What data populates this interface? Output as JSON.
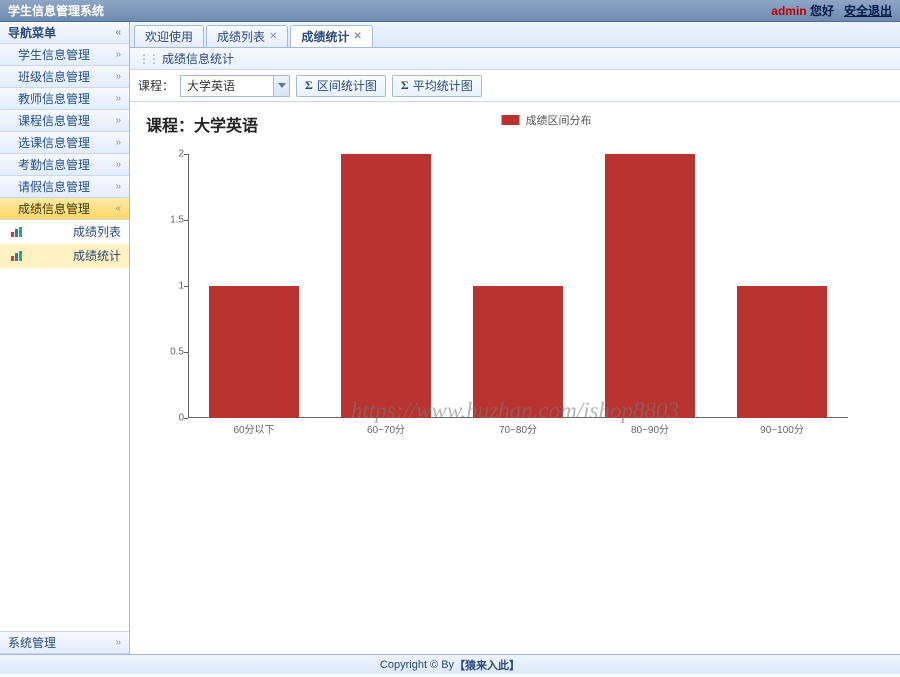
{
  "header": {
    "title": "学生信息管理系统",
    "user": "admin",
    "greet": "您好",
    "logout": "安全退出"
  },
  "sidebar": {
    "title": "导航菜单",
    "items": [
      {
        "label": "学生信息管理",
        "chev": "»"
      },
      {
        "label": "班级信息管理",
        "chev": "»"
      },
      {
        "label": "教师信息管理",
        "chev": "»"
      },
      {
        "label": "课程信息管理",
        "chev": "»"
      },
      {
        "label": "选课信息管理",
        "chev": "»"
      },
      {
        "label": "考勤信息管理",
        "chev": "»"
      },
      {
        "label": "请假信息管理",
        "chev": "»"
      },
      {
        "label": "成绩信息管理",
        "chev": "«"
      }
    ],
    "subitems": [
      {
        "label": "成绩列表"
      },
      {
        "label": "成绩统计"
      }
    ],
    "bottom": {
      "label": "系统管理",
      "chev": "»"
    }
  },
  "tabs": [
    {
      "label": "欢迎使用",
      "closable": false
    },
    {
      "label": "成绩列表",
      "closable": true
    },
    {
      "label": "成绩统计",
      "closable": true,
      "active": true
    }
  ],
  "subbar": {
    "label": "成绩信息统计"
  },
  "toolbar": {
    "course_label": "课程：",
    "course_value": "大学英语",
    "btn_interval": "区间统计图",
    "btn_avg": "平均统计图",
    "sigma": "Σ"
  },
  "chart_data": {
    "type": "bar",
    "title": "课程：大学英语",
    "legend": "成绩区间分布",
    "categories": [
      "60分以下",
      "60~70分",
      "70~80分",
      "80~90分",
      "90~100分"
    ],
    "values": [
      1,
      2,
      1,
      2,
      1
    ],
    "ylabel": "",
    "xlabel": "",
    "ylim": [
      0,
      2
    ],
    "yticks": [
      0,
      0.5,
      1,
      1.5,
      2
    ]
  },
  "watermark": "https://www.huzhan.com/ishop8803",
  "footer": {
    "prefix": "Copyright © By ",
    "bold": "【猿来入此】"
  }
}
